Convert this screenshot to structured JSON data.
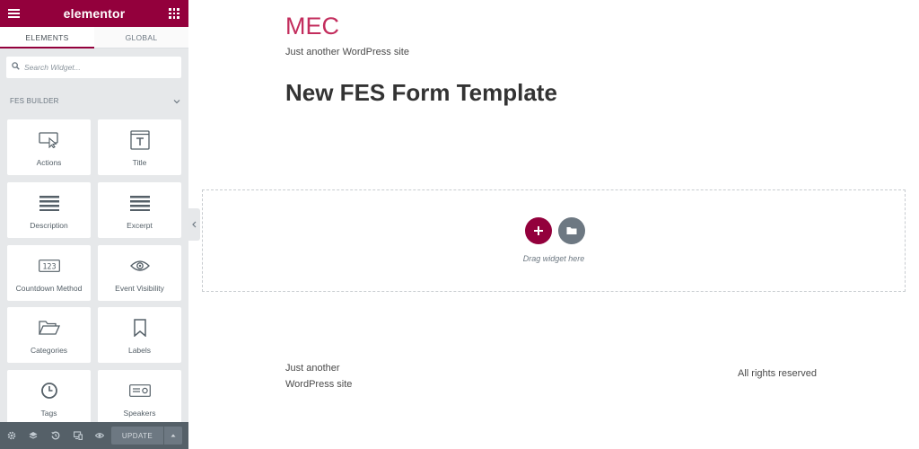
{
  "app": {
    "brand": "elementor"
  },
  "panel": {
    "tabs": [
      {
        "label": "ELEMENTS",
        "active": true
      },
      {
        "label": "GLOBAL",
        "active": false
      }
    ],
    "search": {
      "placeholder": "Search Widget...",
      "value": ""
    },
    "category": {
      "label": "FES BUILDER",
      "icon": "chevron-down-icon"
    },
    "widgets": [
      {
        "label": "Actions",
        "icon": "cursor-click-icon"
      },
      {
        "label": "Title",
        "icon": "title-text-icon"
      },
      {
        "label": "Description",
        "icon": "text-lines-icon"
      },
      {
        "label": "Excerpt",
        "icon": "text-lines-icon"
      },
      {
        "label": "Countdown Method",
        "icon": "counter-123-icon"
      },
      {
        "label": "Event Visibility",
        "icon": "eye-icon"
      },
      {
        "label": "Categories",
        "icon": "folder-open-icon"
      },
      {
        "label": "Labels",
        "icon": "bookmark-icon"
      },
      {
        "label": "Tags",
        "icon": "clock-icon"
      },
      {
        "label": "Speakers",
        "icon": "id-card-icon"
      }
    ],
    "bottombar": {
      "icons": [
        "settings-icon",
        "navigator-layers-icon",
        "history-icon",
        "responsive-mode-icon",
        "preview-eye-icon"
      ],
      "update_label": "UPDATE",
      "update_more_icon": "caret-up-icon"
    }
  },
  "preview": {
    "site_title": "MEC",
    "site_tagline": "Just another WordPress site",
    "page_title": "New FES Form Template",
    "dropzone": {
      "text": "Drag widget here"
    },
    "footer": {
      "tagline": "Just another WordPress site",
      "rights": "All rights reserved"
    }
  },
  "colors": {
    "accent": "#93003c",
    "site_title": "#c32d5d",
    "panel_bg": "#e6e8ea",
    "bottombar_bg": "#556068"
  }
}
